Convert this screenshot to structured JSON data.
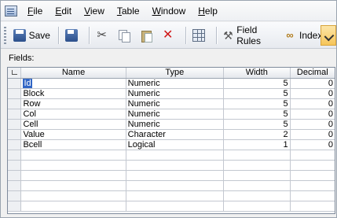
{
  "menu": {
    "items": [
      {
        "label": "File",
        "key": "F",
        "rest": "ile"
      },
      {
        "label": "Edit",
        "key": "E",
        "rest": "dit"
      },
      {
        "label": "View",
        "key": "V",
        "rest": "iew"
      },
      {
        "label": "Table",
        "key": "T",
        "rest": "able"
      },
      {
        "label": "Window",
        "key": "W",
        "rest": "indow"
      },
      {
        "label": "Help",
        "key": "H",
        "rest": "elp"
      }
    ]
  },
  "toolbar": {
    "save_label": "Save",
    "field_rules_label": "Field Rules",
    "indexes_label": "Indexes"
  },
  "fields_label": "Fields:",
  "table": {
    "columns": [
      "Name",
      "Type",
      "Width",
      "Decimal"
    ],
    "rows": [
      {
        "name": "Id",
        "type": "Numeric",
        "width": "5",
        "decimal": "0"
      },
      {
        "name": "Block",
        "type": "Numeric",
        "width": "5",
        "decimal": "0"
      },
      {
        "name": "Row",
        "type": "Numeric",
        "width": "5",
        "decimal": "0"
      },
      {
        "name": "Col",
        "type": "Numeric",
        "width": "5",
        "decimal": "0"
      },
      {
        "name": "Cell",
        "type": "Numeric",
        "width": "5",
        "decimal": "0"
      },
      {
        "name": "Value",
        "type": "Character",
        "width": "2",
        "decimal": "0"
      },
      {
        "name": "Bcell",
        "type": "Logical",
        "width": "1",
        "decimal": "0"
      }
    ]
  },
  "colors": {
    "selection": "#3166c5",
    "toolbar_highlight": "#f6c55a"
  }
}
